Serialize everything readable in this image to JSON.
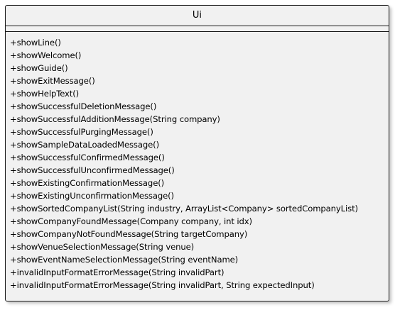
{
  "class": {
    "name": "Ui",
    "attributes": [],
    "methods": [
      "+showLine()",
      "+showWelcome()",
      "+showGuide()",
      "+showExitMessage()",
      "+showHelpText()",
      "+showSuccessfulDeletionMessage()",
      "+showSuccessfulAdditionMessage(String company)",
      "+showSuccessfulPurgingMessage()",
      "+showSampleDataLoadedMessage()",
      "+showSuccessfulConfirmedMessage()",
      "+showSuccessfulUnconfirmedMessage()",
      "+showExistingConfirmationMessage()",
      "+showExistingUnconfirmationMessage()",
      "+showSortedCompanyList(String industry, ArrayList<Company> sortedCompanyList)",
      "+showCompanyFoundMessage(Company company, int idx)",
      "+showCompanyNotFoundMessage(String targetCompany)",
      "+showVenueSelectionMessage(String venue)",
      "+showEventNameSelectionMessage(String eventName)",
      "+invalidInputFormatErrorMessage(String invalidPart)",
      "+invalidInputFormatErrorMessage(String invalidPart, String expectedInput)"
    ]
  },
  "colors": {
    "background": "#f1f1f1",
    "border": "#181818",
    "text": "#000000"
  }
}
